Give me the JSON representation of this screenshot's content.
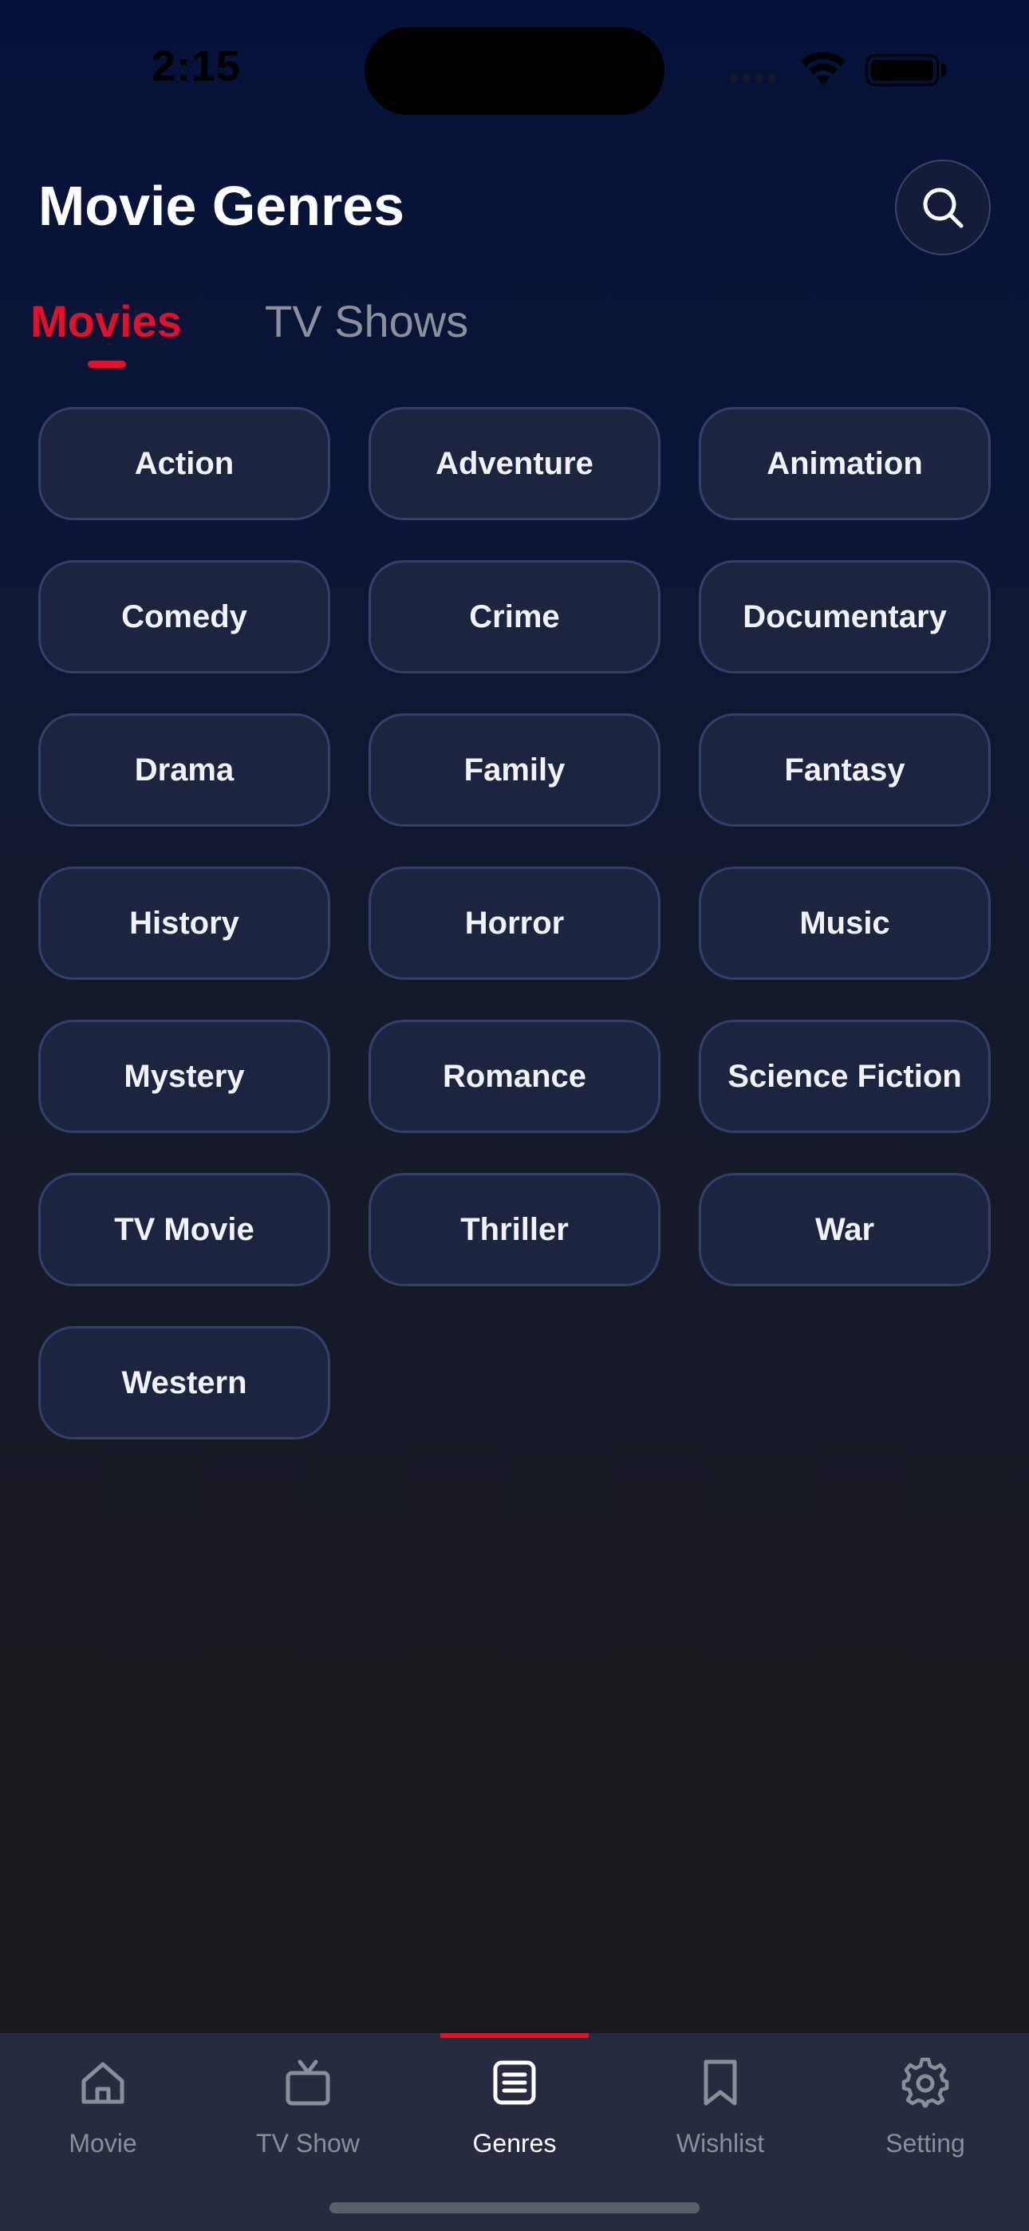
{
  "status_bar": {
    "time": "2:15"
  },
  "header": {
    "title": "Movie Genres",
    "search_icon": "search-icon"
  },
  "tabs": {
    "items": [
      {
        "label": "Movies",
        "active": true
      },
      {
        "label": "TV Shows",
        "active": false
      }
    ],
    "active_color": "#e0112b"
  },
  "genres": [
    "Action",
    "Adventure",
    "Animation",
    "Comedy",
    "Crime",
    "Documentary",
    "Drama",
    "Family",
    "Fantasy",
    "History",
    "Horror",
    "Music",
    "Mystery",
    "Romance",
    "Science Fiction",
    "TV Movie",
    "Thriller",
    "War",
    "Western"
  ],
  "bottom_nav": {
    "items": [
      {
        "label": "Movie",
        "icon": "home-icon",
        "active": false
      },
      {
        "label": "TV Show",
        "icon": "tv-icon",
        "active": false
      },
      {
        "label": "Genres",
        "icon": "list-icon",
        "active": true
      },
      {
        "label": "Wishlist",
        "icon": "bookmark-icon",
        "active": false
      },
      {
        "label": "Setting",
        "icon": "gear-icon",
        "active": false
      }
    ]
  },
  "colors": {
    "accent": "#e0112b",
    "chip_background": "#1c2440",
    "chip_border": "#33406b",
    "nav_background": "#262b40"
  }
}
